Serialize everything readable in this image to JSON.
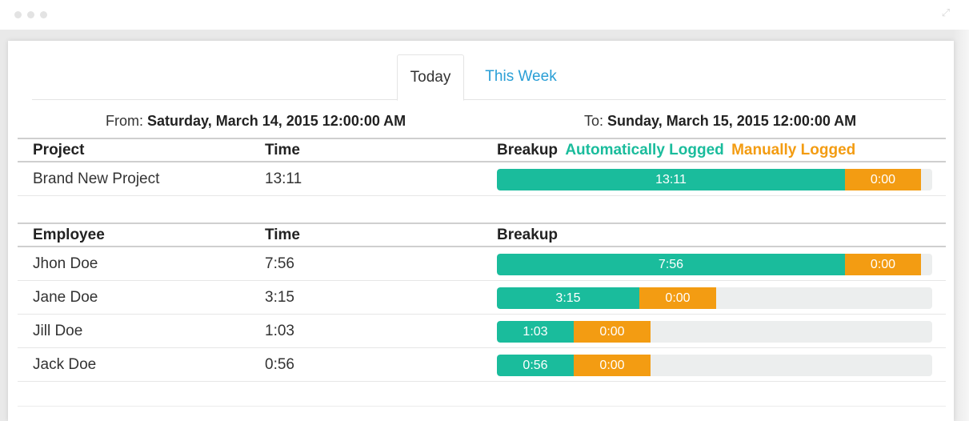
{
  "tabs": [
    {
      "label": "Today",
      "active": true
    },
    {
      "label": "This Week",
      "active": false
    }
  ],
  "range": {
    "from_label": "From:",
    "from_value": "Saturday, March 14, 2015 12:00:00 AM",
    "to_label": "To:",
    "to_value": "Sunday, March 15, 2015 12:00:00 AM"
  },
  "colors": {
    "auto": "#1abc9c",
    "manual": "#f39c12",
    "link": "#2a9fd6",
    "track": "#eceeee"
  },
  "project_table": {
    "headers": {
      "name": "Project",
      "time": "Time",
      "breakup": "Breakup"
    },
    "legend": {
      "auto": "Automatically Logged",
      "manual": "Manually Logged"
    },
    "rows": [
      {
        "name": "Brand New Project",
        "time": "13:11",
        "auto_label": "13:11",
        "manual_label": "0:00",
        "auto_fraction": 0.8,
        "manual_fraction": 0.175
      }
    ]
  },
  "employee_table": {
    "headers": {
      "name": "Employee",
      "time": "Time",
      "breakup": "Breakup"
    },
    "rows": [
      {
        "name": "Jhon Doe",
        "time": "7:56",
        "auto_label": "7:56",
        "manual_label": "0:00",
        "auto_fraction": 0.8,
        "manual_fraction": 0.175
      },
      {
        "name": "Jane Doe",
        "time": "3:15",
        "auto_label": "3:15",
        "manual_label": "0:00",
        "auto_fraction": 0.327,
        "manual_fraction": 0.176
      },
      {
        "name": "Jill Doe",
        "time": "1:03",
        "auto_label": "1:03",
        "manual_label": "0:00",
        "auto_fraction": 0.176,
        "manual_fraction": 0.176
      },
      {
        "name": "Jack Doe",
        "time": "0:56",
        "auto_label": "0:56",
        "manual_label": "0:00",
        "auto_fraction": 0.176,
        "manual_fraction": 0.176
      }
    ]
  }
}
